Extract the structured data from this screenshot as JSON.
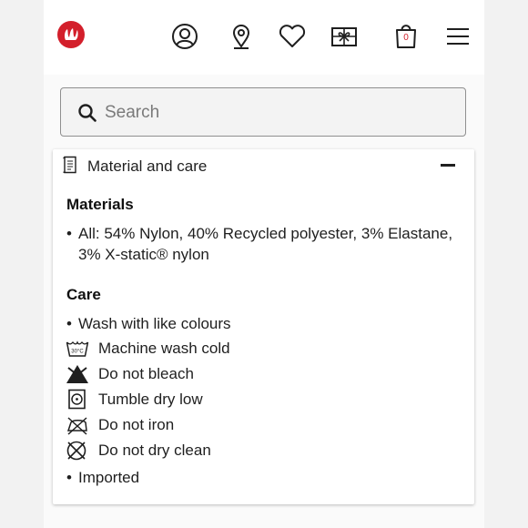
{
  "header": {
    "brand": "lululemon",
    "bag_count": "0",
    "icons": [
      "account-icon",
      "store-locator-icon",
      "wishlist-icon",
      "gift-card-icon",
      "shopping-bag-icon",
      "menu-icon"
    ]
  },
  "search": {
    "placeholder": "Search",
    "value": ""
  },
  "accordion": {
    "title": "Material and care",
    "expanded": true
  },
  "materials": {
    "heading": "Materials",
    "items": [
      "All: 54% Nylon, 40% Recycled polyester, 3% Elastane, 3% X-static® nylon"
    ]
  },
  "care": {
    "heading": "Care",
    "items": [
      {
        "icon": "bullet",
        "text": "Wash with like colours"
      },
      {
        "icon": "machine-wash-cold-icon",
        "text": "Machine wash cold"
      },
      {
        "icon": "do-not-bleach-icon",
        "text": "Do not bleach"
      },
      {
        "icon": "tumble-dry-low-icon",
        "text": "Tumble dry low"
      },
      {
        "icon": "do-not-iron-icon",
        "text": "Do not iron"
      },
      {
        "icon": "do-not-dry-clean-icon",
        "text": "Do not dry clean"
      },
      {
        "icon": "bullet",
        "text": "Imported"
      }
    ]
  },
  "colors": {
    "brand_red": "#d31f2b",
    "text": "#1f1f1f"
  }
}
